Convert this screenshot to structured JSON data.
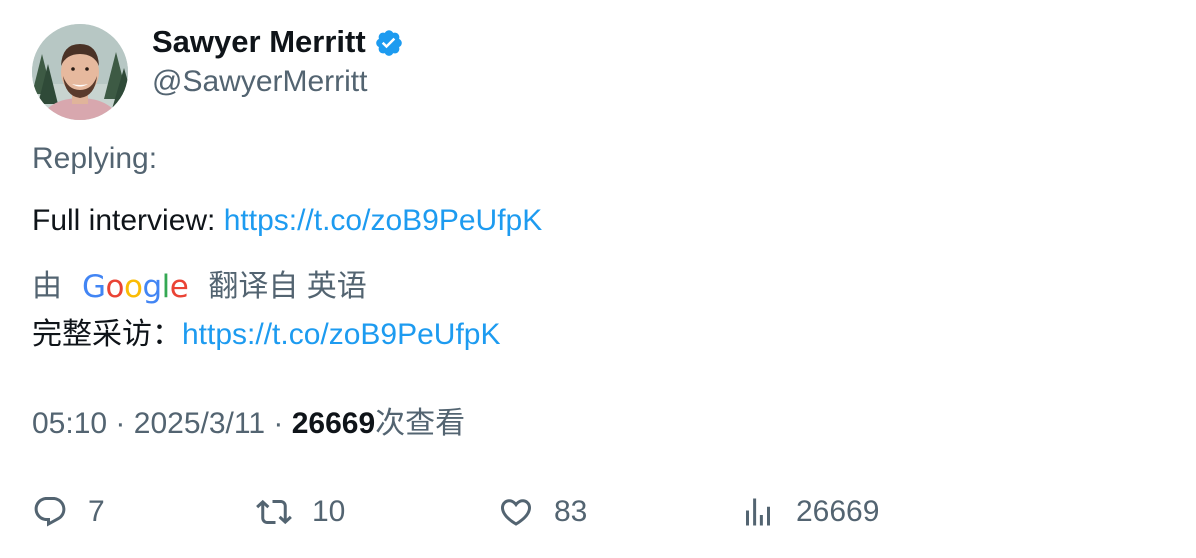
{
  "author": {
    "name": "Sawyer Merritt",
    "handle": "@SawyerMerritt",
    "verified_icon": "verified-badge-icon",
    "verified_color": "#1d9bf0"
  },
  "tweet": {
    "replying_label": "Replying:",
    "text_prefix": "Full interview: ",
    "link": "https://t.co/zoB9PeUfpK"
  },
  "translation": {
    "by_label": "由",
    "google_brand": "Google",
    "from_label": "翻译自 英语",
    "text_prefix": "完整采访：",
    "link": "https://t.co/zoB9PeUfpK"
  },
  "meta": {
    "time": "05:10",
    "separator": "·",
    "date": "2025/3/11",
    "views_count": "26669",
    "views_label": "次查看"
  },
  "actions": {
    "reply_count": "7",
    "retweet_count": "10",
    "like_count": "83",
    "views_count": "26669"
  },
  "colors": {
    "link": "#1d9bf0",
    "secondary_text": "#536471",
    "primary_text": "#0f1419"
  }
}
